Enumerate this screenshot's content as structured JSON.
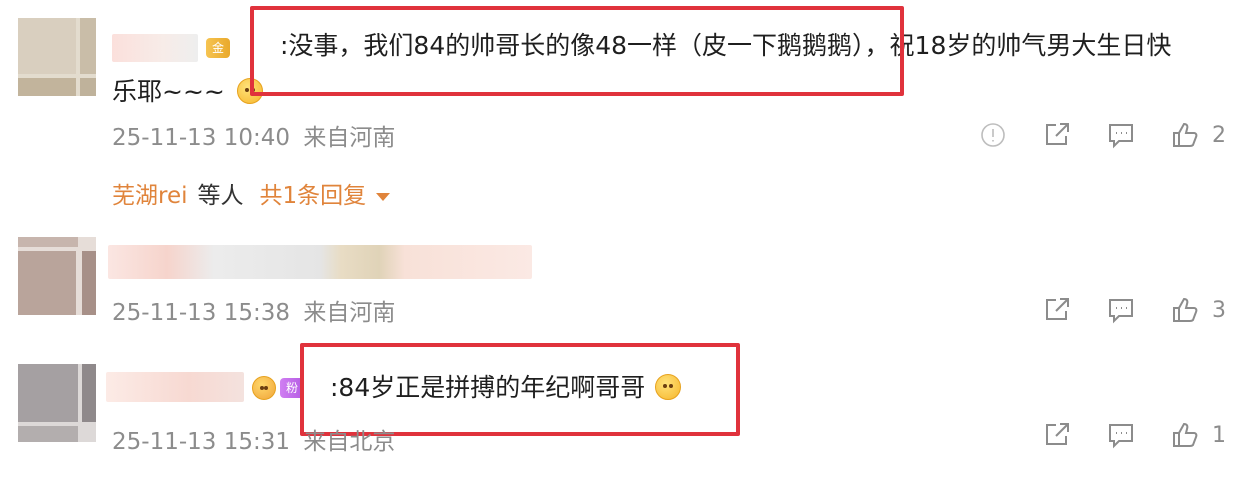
{
  "comments": [
    {
      "name_redacted": true,
      "badge": "金",
      "text_line1": ":没事，我们84的帅哥长的像48一样（皮一下鹅鹅鹅），祝18岁的帅气男大生日快",
      "text_line2": "乐耶~~~",
      "timestamp": "25-11-13 10:40",
      "location": "来自河南",
      "share_count": "",
      "comment_count": "",
      "like_count": "2",
      "reply_user": "芜湖rei",
      "reply_mid": "等人",
      "reply_total": "共1条回复"
    },
    {
      "name_redacted": true,
      "text_line1": "",
      "timestamp": "25-11-13 15:38",
      "location": "来自河南",
      "like_count": "3"
    },
    {
      "name_redacted": true,
      "badge": "粉",
      "text_line1": ":84岁正是拼搏的年纪啊哥哥",
      "timestamp": "25-11-13 15:31",
      "location": "来自北京",
      "like_count": "1"
    }
  ],
  "colors": {
    "highlight_box": "#e0323c",
    "reply_accent": "#e0843b",
    "meta_gray": "#8c8c8c"
  },
  "icons": [
    "report-icon",
    "share-icon",
    "comment-icon",
    "like-icon"
  ]
}
